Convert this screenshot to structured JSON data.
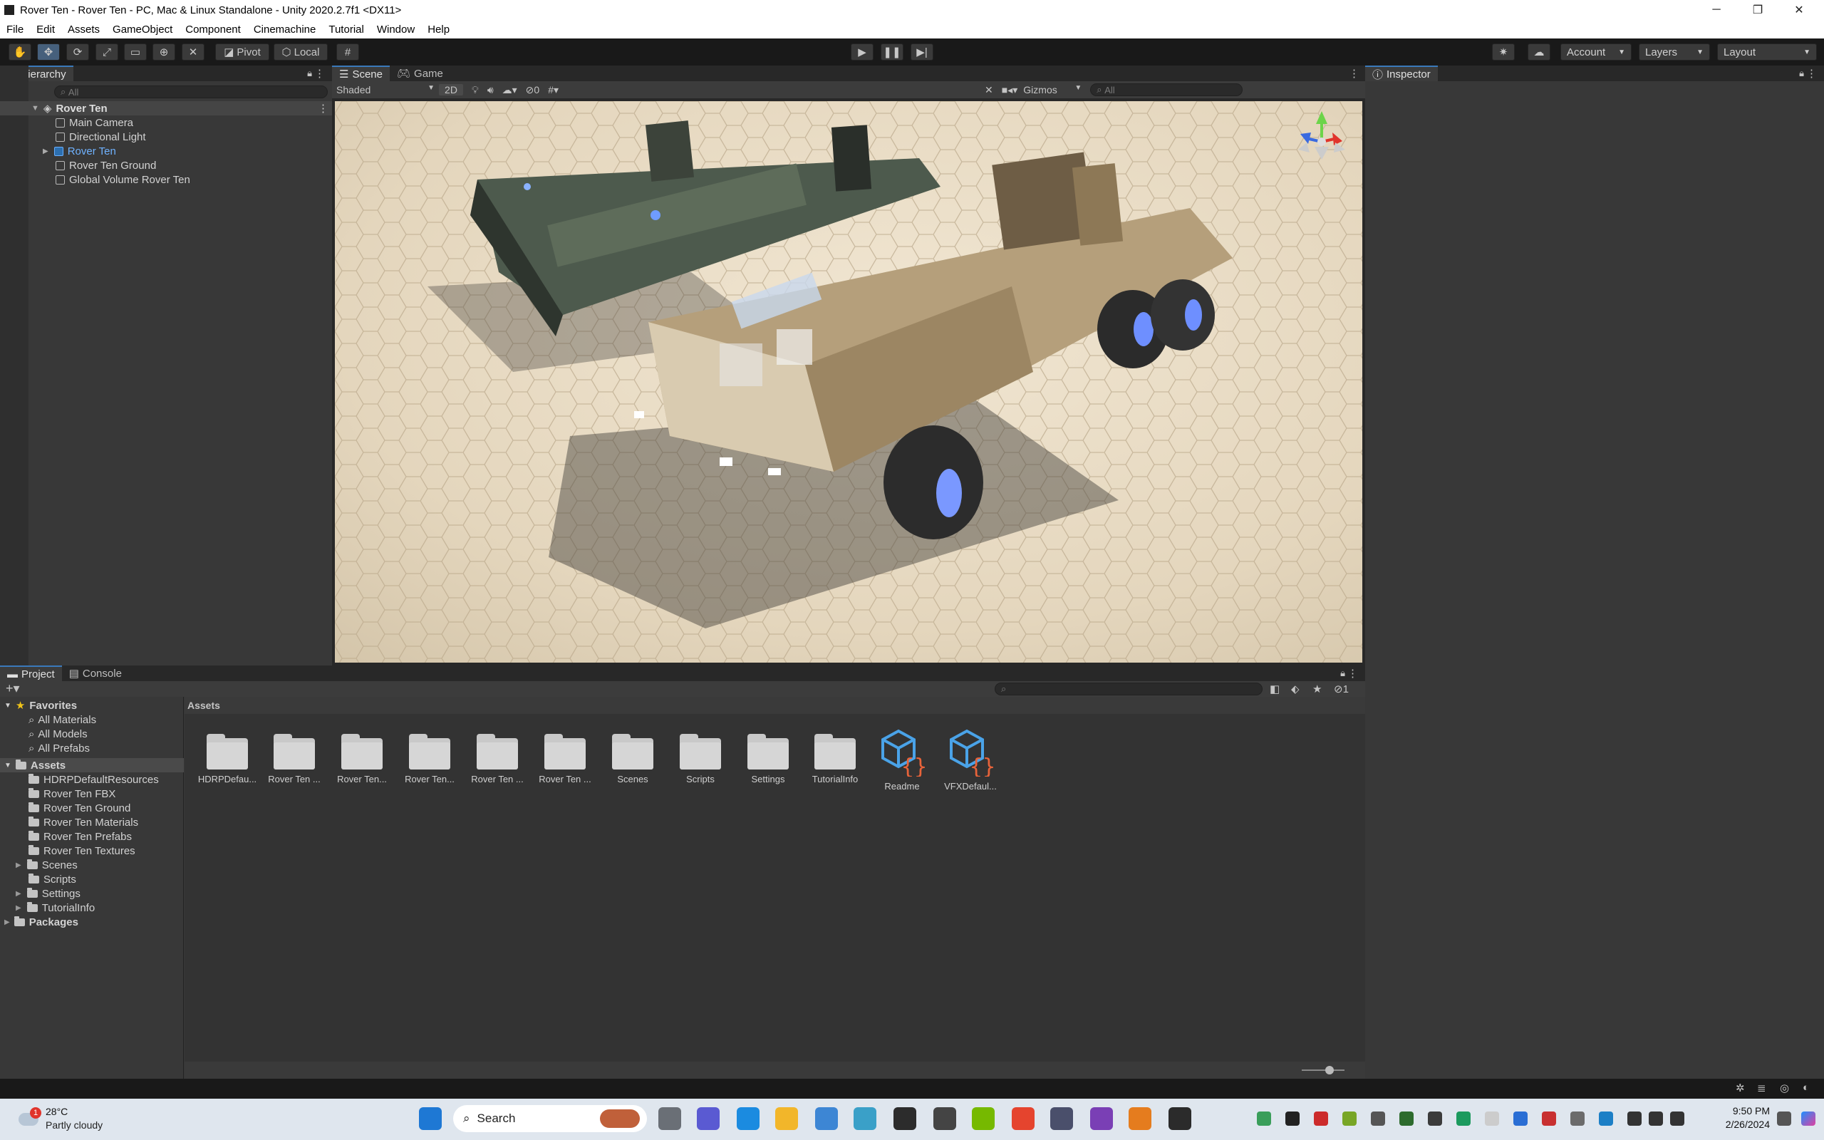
{
  "window": {
    "title": "Rover Ten - Rover Ten - PC, Mac & Linux Standalone - Unity 2020.2.7f1 <DX11>",
    "controls": [
      "─",
      "❐",
      "✕"
    ]
  },
  "menu": [
    "File",
    "Edit",
    "Assets",
    "GameObject",
    "Component",
    "Cinemachine",
    "Tutorial",
    "Window",
    "Help"
  ],
  "toolbar": {
    "pivot": "Pivot",
    "local": "Local",
    "account": "Account",
    "layers": "Layers",
    "layout": "Layout"
  },
  "hierarchy": {
    "tab": "Hierarchy",
    "search_placeholder": "All",
    "scene": "Rover Ten",
    "items": [
      {
        "label": "Main Camera"
      },
      {
        "label": "Directional Light"
      },
      {
        "label": "Rover Ten"
      },
      {
        "label": "Rover Ten Ground"
      },
      {
        "label": "Global Volume Rover Ten"
      }
    ]
  },
  "scene_view": {
    "tabs": [
      "Scene",
      "Game"
    ],
    "shading": "Shaded",
    "mode_2d": "2D",
    "hidden_count": "0",
    "gizmos": "Gizmos",
    "search_placeholder": "All"
  },
  "inspector": {
    "tab": "Inspector"
  },
  "project": {
    "tabs": [
      "Project",
      "Console"
    ],
    "favorites_label": "Favorites",
    "favorites": [
      "All Materials",
      "All Models",
      "All Prefabs"
    ],
    "assets_label": "Assets",
    "asset_tree": [
      "HDRPDefaultResources",
      "Rover Ten FBX",
      "Rover Ten Ground",
      "Rover Ten Materials",
      "Rover Ten Prefabs",
      "Rover Ten Textures",
      "Scenes",
      "Scripts",
      "Settings",
      "TutorialInfo"
    ],
    "packages_label": "Packages",
    "breadcrumb": "Assets",
    "hidden_count": "1",
    "grid": [
      {
        "label": "HDRPDefau...",
        "kind": "folder"
      },
      {
        "label": "Rover Ten ...",
        "kind": "folder"
      },
      {
        "label": "Rover Ten...",
        "kind": "folder"
      },
      {
        "label": "Rover Ten...",
        "kind": "folder"
      },
      {
        "label": "Rover Ten ...",
        "kind": "folder"
      },
      {
        "label": "Rover Ten ...",
        "kind": "folder"
      },
      {
        "label": "Scenes",
        "kind": "folder"
      },
      {
        "label": "Scripts",
        "kind": "folder"
      },
      {
        "label": "Settings",
        "kind": "folder"
      },
      {
        "label": "TutorialInfo",
        "kind": "folder"
      },
      {
        "label": "Readme",
        "kind": "script-asset"
      },
      {
        "label": "VFXDefaul...",
        "kind": "script-asset"
      }
    ]
  },
  "taskbar": {
    "weather_temp": "28°C",
    "weather_desc": "Partly cloudy",
    "weather_badge": "1",
    "search": "Search",
    "time": "9:50 PM",
    "date": "2/26/2024"
  },
  "colors": {
    "selection": "#2c5d87",
    "tab_accent": "#3a79bb",
    "editor_bg": "#383838"
  }
}
